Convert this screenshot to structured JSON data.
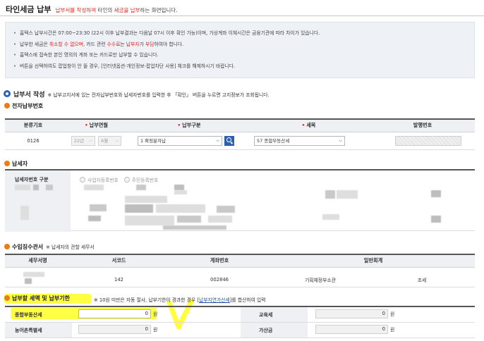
{
  "page": {
    "title": "타인세금 납부",
    "subtitle_1": "납부서를 작성하여",
    "subtitle_2": " 타인의 ",
    "subtitle_3": "세금을 납부",
    "subtitle_4": "하는 화면입니다."
  },
  "notice": {
    "item1": "홈택스 납부시간은 07:00~23:30 (22시 이후 납부결과는 다음날 07시 이후 확인 가능)이며, 가상계좌 이체시간은 금융기관에 따라 차이가 있습니다.",
    "item2_a": "납부한 세금은 ",
    "item2_b": "취소할 수 없으며",
    "item2_c": ", 카드 관련 ",
    "item2_d": "수수료",
    "item2_e": "는 ",
    "item2_f": "납부자",
    "item2_g": "가 ",
    "item2_h": "부담",
    "item2_i": "하여야 합니다.",
    "item3": "홈택스에 접속한 본인 명의의 계좌 또는 카드로만 납부할 수 있습니다.",
    "item4": "버튼을 선택하여도 팝업창이 안 뜰 경우, [인터넷옵션-개인정보-팝업차단 사용] 체크를 해제하시기 바랍니다."
  },
  "payment_form": {
    "heading": "납부서 작성",
    "description": "※ 납부고지서에 있는 전자납부번호와 납세자번호를 입력한 후 「확인」 버튼을 누르면 고지정보가 조회됩니다."
  },
  "electronic_number": {
    "heading": "전자납부번호",
    "columns": {
      "classification": "분류기호",
      "year_month": "납부연월",
      "payment_type": "납부구분",
      "tax_item": "세목",
      "issue_number": "발행번호"
    },
    "row": {
      "classification": "0126",
      "year": "22년",
      "month": "6월",
      "payment_type": "1 확정분자납",
      "tax_item": "57 종합부동산세"
    }
  },
  "taxpayer": {
    "heading": "납세자",
    "id_type_label": "납세자번호 구분",
    "radio_business": "사업자등록번호",
    "radio_resident": "주민등록번호"
  },
  "revenue_office": {
    "heading": "수입징수관서",
    "note": "※ 납세자의 관할 세무서",
    "columns": {
      "office_name": "세무서명",
      "office_code": "서코드",
      "account_number": "계좌번호",
      "general_account": "일반회계"
    },
    "row": {
      "office_code": "142",
      "account_number": "002846",
      "ministry": "기획재정부소관",
      "tax_type": "조세"
    }
  },
  "tax_amount": {
    "heading": "납부할 세액 및 납부기한",
    "note_1": "※ 10원 미만은 자동 절사, 납부기한이 경과한 경우 [",
    "note_link": "납부지연가산세",
    "note_2": "]를 합산하여 입력",
    "rows": [
      {
        "label": "종합부동산세",
        "value": "0",
        "unit": "원",
        "label2": "교육세",
        "value2": "0",
        "unit2": "원"
      },
      {
        "label": "농어촌특별세",
        "value": "0",
        "unit": "원",
        "label2": "가산금",
        "value2": "0",
        "unit2": "원"
      }
    ]
  },
  "colors": {
    "accent_blue": "#2d62b5",
    "alert_red": "#e0241a",
    "section_orange": "#ec7b18",
    "highlight_yellow": "#ffff3a"
  }
}
